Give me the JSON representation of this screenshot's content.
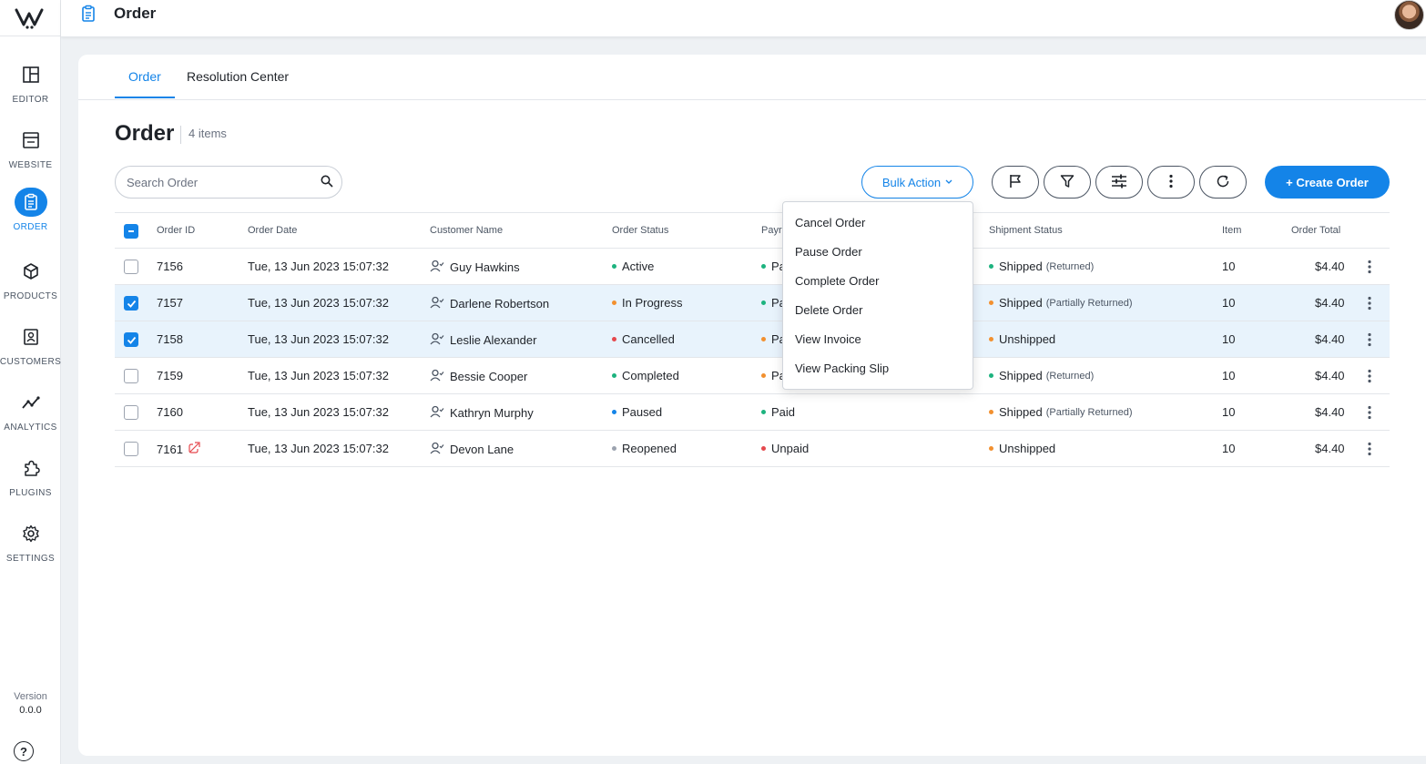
{
  "app": {
    "title": "Order"
  },
  "sidebar": {
    "items": [
      {
        "label": "EDITOR",
        "icon": "layout-icon"
      },
      {
        "label": "WEBSITE",
        "icon": "browser-icon"
      },
      {
        "label": "ORDER",
        "icon": "clipboard-icon"
      },
      {
        "label": "PRODUCTS",
        "icon": "cube-icon"
      },
      {
        "label": "CUSTOMERS",
        "icon": "contacts-icon"
      },
      {
        "label": "ANALYTICS",
        "icon": "trend-icon"
      },
      {
        "label": "PLUGINS",
        "icon": "puzzle-icon"
      },
      {
        "label": "SETTINGS",
        "icon": "gear-icon"
      }
    ],
    "active": "ORDER",
    "version_label": "Version",
    "version_value": "0.0.0",
    "help": "?"
  },
  "tabs": [
    {
      "label": "Order"
    },
    {
      "label": "Resolution Center"
    }
  ],
  "page": {
    "title": "Order",
    "count": "4 items"
  },
  "toolbar": {
    "search_placeholder": "Search Order",
    "bulk_label": "Bulk Action",
    "create_label": "+ Create Order"
  },
  "table": {
    "headers": [
      "Order ID",
      "Order Date",
      "Customer Name",
      "Order Status",
      "Payr",
      "Shipment Status",
      "Item",
      "Order Total"
    ],
    "rows": [
      {
        "checked": false,
        "id": "7156",
        "date": "Tue, 13 Jun 2023 15:07:32",
        "customer": "Guy Hawkins",
        "status": "Active",
        "status_color": "#1db37f",
        "payment": "Pa",
        "payment_color": "#1db37f",
        "shipment": "Shipped",
        "shipment_note": "(Returned)",
        "shipment_color": "#1db37f",
        "item": "10",
        "total": "$4.40"
      },
      {
        "checked": true,
        "id": "7157",
        "date": "Tue, 13 Jun 2023 15:07:32",
        "customer": "Darlene Robertson",
        "status": "In Progress",
        "status_color": "#f2902f",
        "payment": "Pa",
        "payment_color": "#1db37f",
        "shipment": "Shipped",
        "shipment_note": "(Partially Returned)",
        "shipment_color": "#f2902f",
        "item": "10",
        "total": "$4.40"
      },
      {
        "checked": true,
        "id": "7158",
        "date": "Tue, 13 Jun 2023 15:07:32",
        "customer": "Leslie Alexander",
        "status": "Cancelled",
        "status_color": "#e5484d",
        "payment": "Pa",
        "payment_color": "#f2902f",
        "shipment": "Unshipped",
        "shipment_note": "",
        "shipment_color": "#f2902f",
        "item": "10",
        "total": "$4.40"
      },
      {
        "checked": false,
        "id": "7159",
        "date": "Tue, 13 Jun 2023 15:07:32",
        "customer": "Bessie Cooper",
        "status": "Completed",
        "status_color": "#1db37f",
        "payment": "Pa",
        "payment_color": "#f2902f",
        "shipment": "Shipped",
        "shipment_note": "(Returned)",
        "shipment_color": "#1db37f",
        "item": "10",
        "total": "$4.40"
      },
      {
        "checked": false,
        "id": "7160",
        "date": "Tue, 13 Jun 2023 15:07:32",
        "customer": "Kathryn Murphy",
        "status": "Paused",
        "status_color": "#1484e8",
        "payment": "Paid",
        "payment_color": "#1db37f",
        "shipment": "Shipped",
        "shipment_note": "(Partially Returned)",
        "shipment_color": "#f2902f",
        "item": "10",
        "total": "$4.40"
      },
      {
        "checked": false,
        "id": "7161",
        "date": "Tue, 13 Jun 2023 15:07:32",
        "customer": "Devon Lane",
        "status": "Reopened",
        "status_color": "#9ca3af",
        "payment": "Unpaid",
        "payment_color": "#e5484d",
        "shipment": "Unshipped",
        "shipment_note": "",
        "shipment_color": "#f2902f",
        "item": "10",
        "total": "$4.40"
      }
    ]
  },
  "bulk_menu": [
    "Cancel Order",
    "Pause Order",
    "Complete Order",
    "Delete Order",
    "View Invoice",
    "View Packing Slip"
  ],
  "colors": {
    "accent": "#1484e8"
  }
}
